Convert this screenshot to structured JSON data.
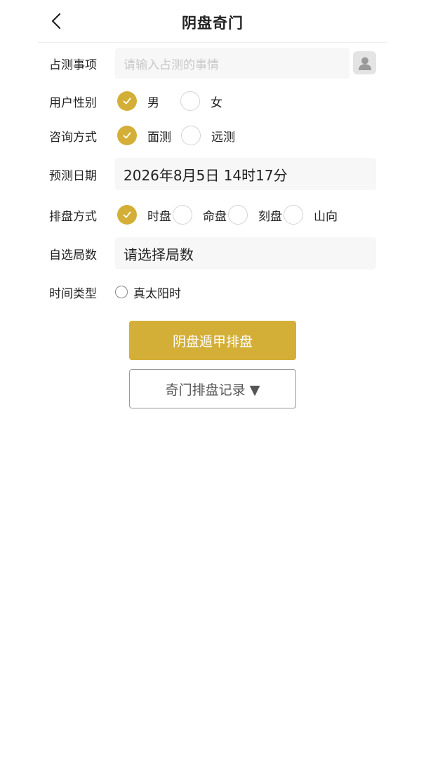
{
  "header": {
    "title": "阴盘奇门"
  },
  "form": {
    "matter": {
      "label": "占测事项",
      "placeholder": "请输入占测的事情"
    },
    "gender": {
      "label": "用户性别",
      "options": [
        {
          "label": "男",
          "selected": true
        },
        {
          "label": "女",
          "selected": false
        }
      ]
    },
    "consult": {
      "label": "咨询方式",
      "options": [
        {
          "label": "面测",
          "selected": true
        },
        {
          "label": "远测",
          "selected": false
        }
      ]
    },
    "date": {
      "label": "预测日期",
      "value": "2026年8月5日 14时17分"
    },
    "plate_method": {
      "label": "排盘方式",
      "options": [
        {
          "label": "时盘",
          "selected": true
        },
        {
          "label": "命盘",
          "selected": false
        },
        {
          "label": "刻盘",
          "selected": false
        },
        {
          "label": "山向",
          "selected": false
        }
      ]
    },
    "ju": {
      "label": "自选局数",
      "value": "请选择局数"
    },
    "time_type": {
      "label": "时间类型",
      "option_label": "真太阳时",
      "selected": false
    }
  },
  "actions": {
    "submit_label": "阴盘遁甲排盘",
    "history_label": "奇门排盘记录 ▼"
  },
  "colors": {
    "accent": "#d4af37"
  },
  "icons": {
    "back": "back-chevron-icon",
    "avatar": "user-avatar-icon",
    "check": "check-icon"
  }
}
